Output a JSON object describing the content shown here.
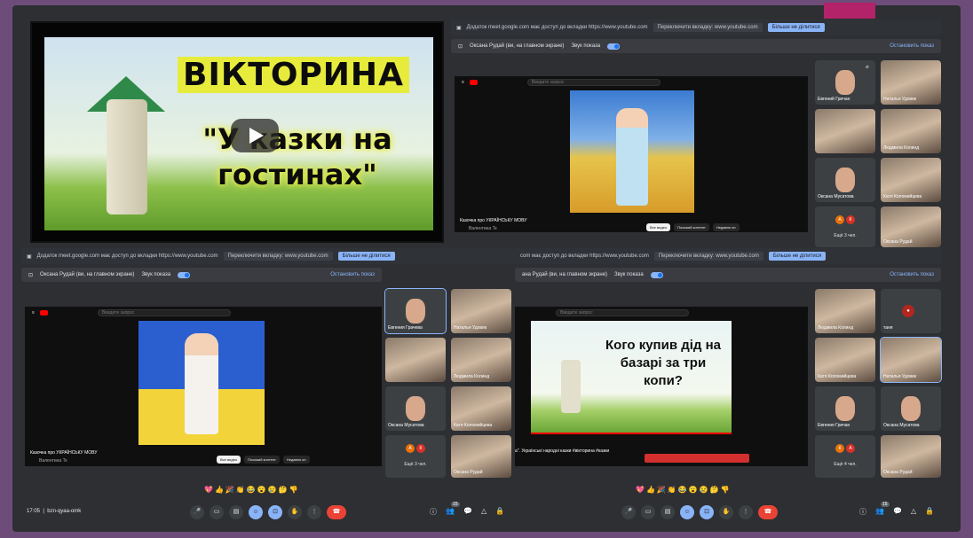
{
  "video": {
    "title": "ВІКТОРИНА",
    "subtitle": "\"У казки на гостинах\""
  },
  "share_notice": {
    "text_full": "Додаток meet.google.com має доступ до вкладки https://www.youtube.com",
    "text_short": "com має доступ до вкладки https://www.youtube.com",
    "switch_label": "Переключити вкладку: www.youtube.com",
    "stop_label": "Більше не ділитися"
  },
  "presenting": {
    "presenter": "Оксана Рудай (ви, на главном экране)",
    "presenter_short": "ана Рудай (ви, на главном экране)",
    "sound_label": "Звук показа",
    "stop": "Остановить показ"
  },
  "youtube": {
    "search_placeholder": "Введите запрос",
    "video_title": "Казочка про УКРАЇНСЬКУ МОВУ",
    "channel": "Валентина Тк",
    "chips": [
      "Все видео",
      "Похожий контент",
      "Недавно оп"
    ],
    "mid_caption": "а\". Українські народні казки #вікторина #казки",
    "riddle": "Кого купив дід на базарі за три копи?"
  },
  "participants": {
    "top": [
      "Евгений Гричан",
      "Наталья Удовик",
      "",
      "Людмила Колинд",
      "Оксана Мусатова",
      "Катя Коломийцева",
      "",
      "Оксана Рудай"
    ],
    "bottom_left": [
      "Евгения Грачева",
      "Наталья Удовик",
      "",
      "Людмила Колинд",
      "Оксана Мусатова",
      "Катя Коломийцева",
      "",
      "Оксана Рудай"
    ],
    "bottom_right": [
      "Людмила Колинд",
      "таня",
      "Катя Коломийцева",
      "Наталья Удовик",
      "Евгения Гричан",
      "Оксана Мусатова",
      "",
      "Оксана Рудай"
    ],
    "more_a": "Ещё 3 чел.",
    "more_b": "Ещё 3 чел.",
    "more_c": "Ещё 4 чел."
  },
  "meeting": {
    "time": "17:05",
    "code": "bzn-qyaa-omk",
    "people_badge": "15"
  },
  "colors": {
    "accent": "#8ab4f8",
    "end_call": "#ea4335",
    "bg": "#6e4c79"
  }
}
